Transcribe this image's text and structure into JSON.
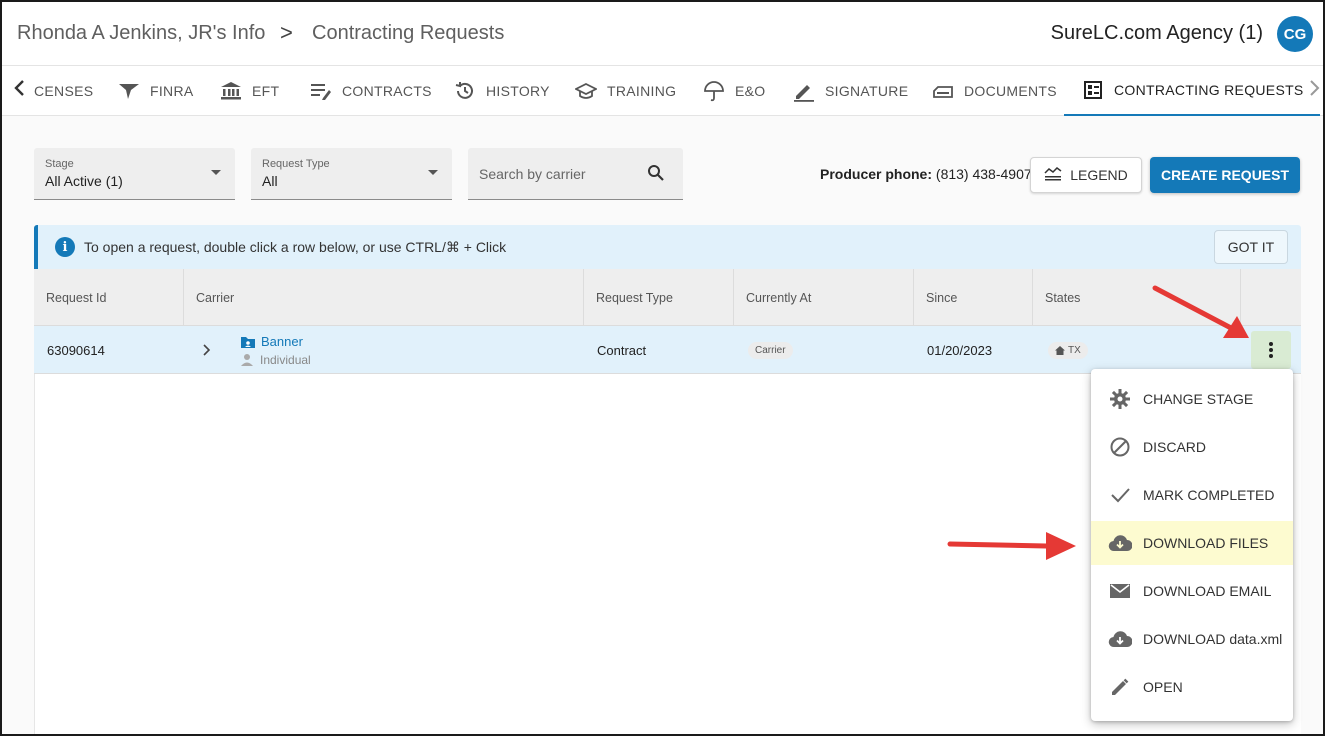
{
  "header": {
    "breadcrumb_parent": "Rhonda A Jenkins, JR's Info",
    "breadcrumb_separator": ">",
    "breadcrumb_current": "Contracting Requests",
    "agency": "SureLC.com Agency (1)",
    "avatar_initials": "CG"
  },
  "tabs": [
    {
      "label": "CENSES",
      "icon": "licenses-icon"
    },
    {
      "label": "FINRA",
      "icon": "finra-icon"
    },
    {
      "label": "EFT",
      "icon": "bank-icon"
    },
    {
      "label": "CONTRACTS",
      "icon": "contracts-icon"
    },
    {
      "label": "HISTORY",
      "icon": "history-icon"
    },
    {
      "label": "TRAINING",
      "icon": "training-cap-icon"
    },
    {
      "label": "E&O",
      "icon": "umbrella-icon"
    },
    {
      "label": "SIGNATURE",
      "icon": "signature-pen-icon"
    },
    {
      "label": "DOCUMENTS",
      "icon": "documents-icon"
    },
    {
      "label": "CONTRACTING REQUESTS",
      "icon": "contracting-requests-icon",
      "active": true
    }
  ],
  "filters": {
    "stage_label": "Stage",
    "stage_value": "All Active (1)",
    "request_type_label": "Request Type",
    "request_type_value": "All",
    "search_placeholder": "Search by carrier"
  },
  "toolbar": {
    "phone_label": "Producer phone:",
    "phone_value": "(813) 438-4907",
    "legend_label": "LEGEND",
    "create_label": "CREATE REQUEST"
  },
  "banner": {
    "text": "To open a request, double click a row below, or use CTRL/⌘ + Click",
    "button": "GOT IT"
  },
  "table": {
    "columns": [
      "Request Id",
      "Carrier",
      "Request Type",
      "Currently At",
      "Since",
      "States"
    ],
    "rows": [
      {
        "request_id": "63090614",
        "carrier": "Banner",
        "carrier_sub": "Individual",
        "request_type": "Contract",
        "currently_at": "Carrier",
        "since": "01/20/2023",
        "state": "TX"
      }
    ]
  },
  "menu": {
    "items": [
      {
        "label": "CHANGE STAGE",
        "icon": "gear-icon"
      },
      {
        "label": "DISCARD",
        "icon": "block-icon"
      },
      {
        "label": "MARK COMPLETED",
        "icon": "check-icon"
      },
      {
        "label": "DOWNLOAD FILES",
        "icon": "cloud-download-icon",
        "highlighted": true
      },
      {
        "label": "DOWNLOAD EMAIL",
        "icon": "email-icon"
      },
      {
        "label": "DOWNLOAD data.xml",
        "icon": "cloud-download-icon"
      },
      {
        "label": "OPEN",
        "icon": "pencil-icon"
      }
    ]
  },
  "colors": {
    "primary": "#1479b8",
    "banner_bg": "#e1f1fb",
    "highlight": "#fdfbd0",
    "annotation_arrow": "#e53935"
  }
}
